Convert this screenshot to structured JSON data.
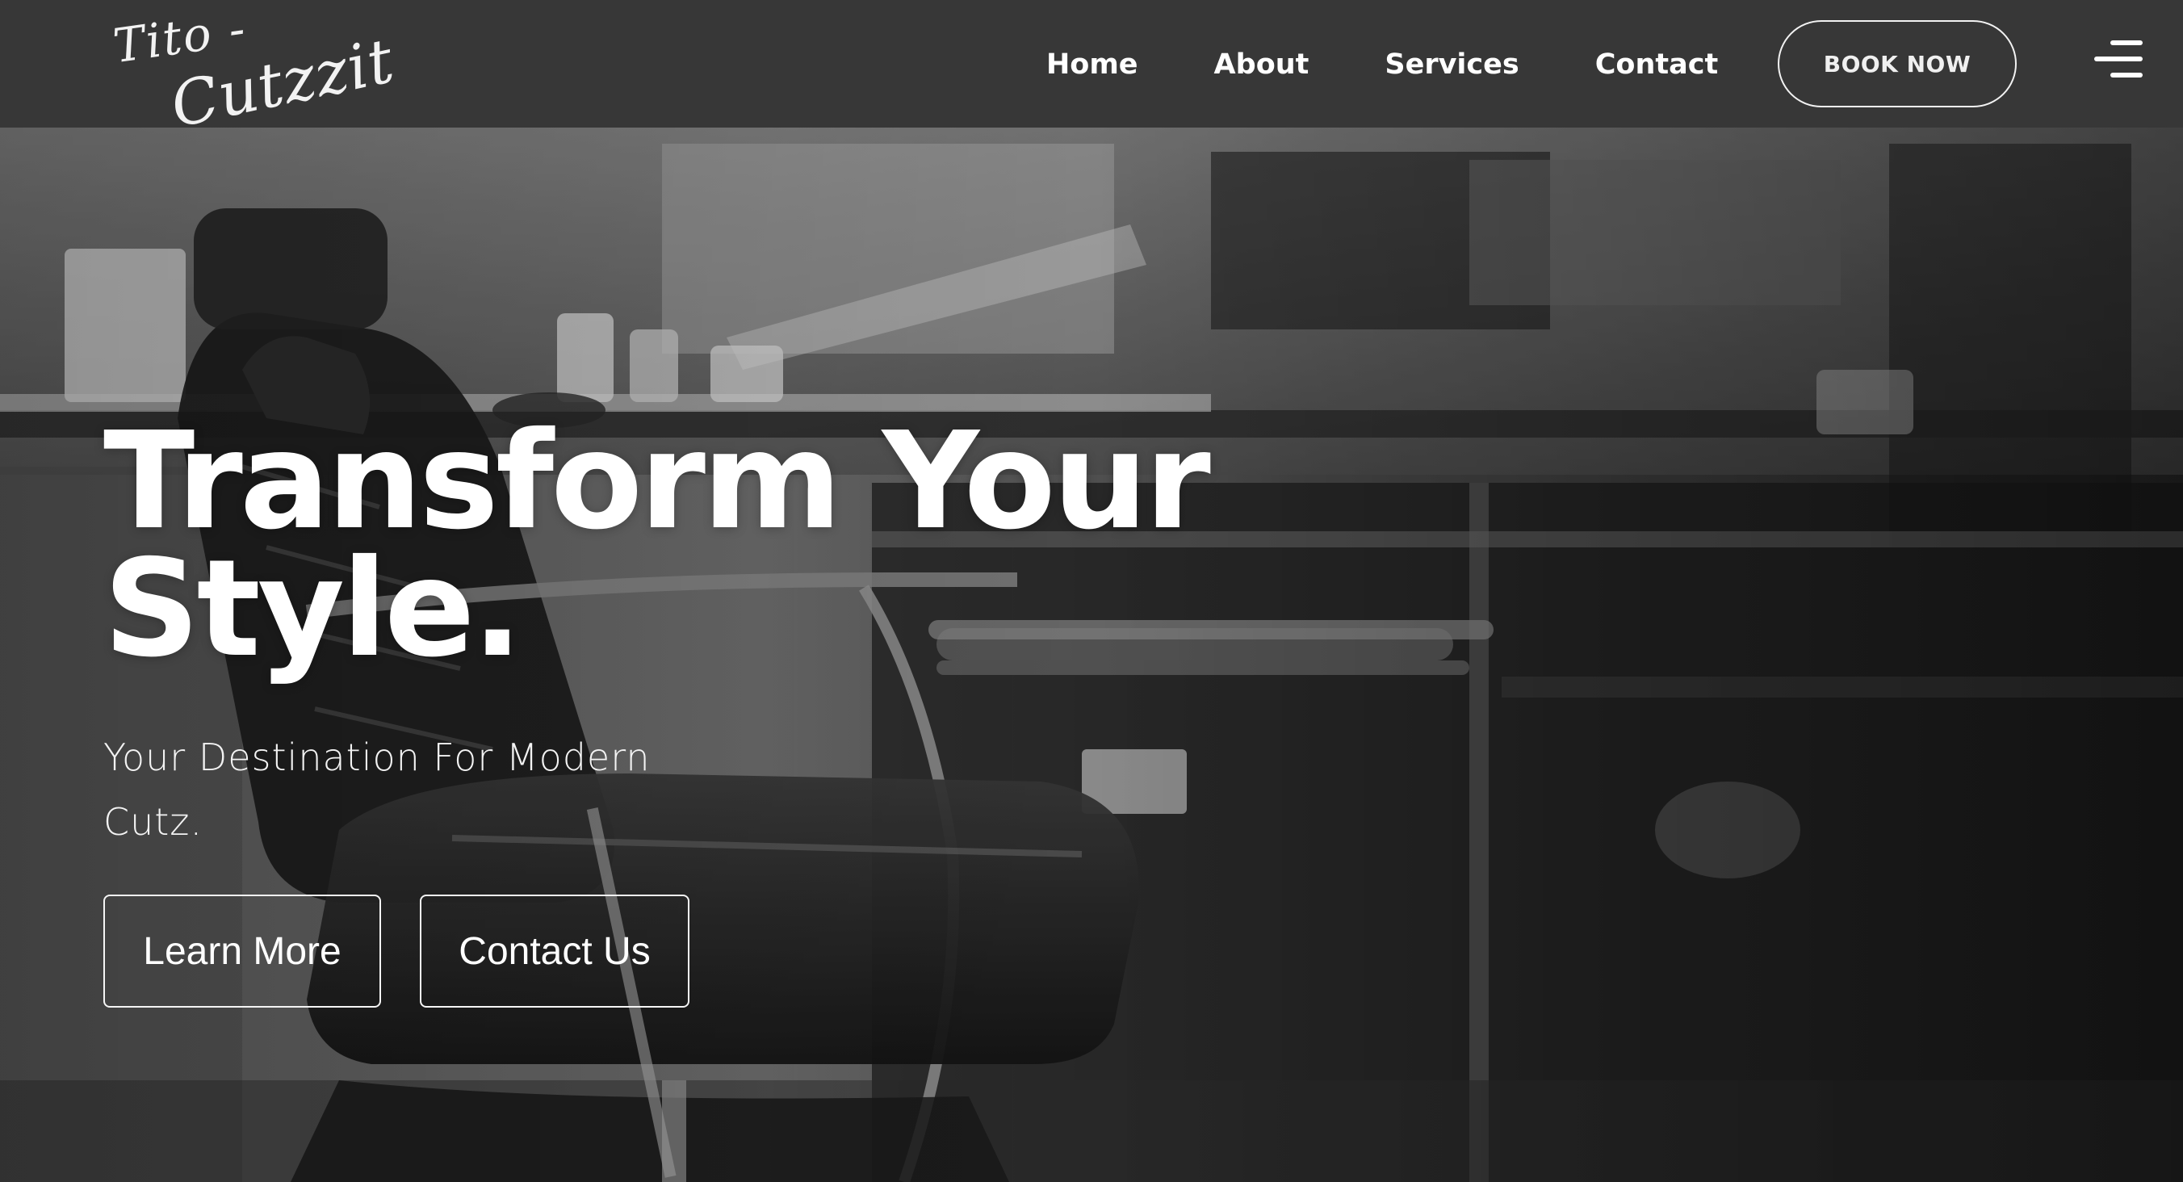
{
  "header": {
    "logo": {
      "line1": "Tito -",
      "line2": "Cutzzit"
    },
    "nav": [
      {
        "label": "Home"
      },
      {
        "label": "About"
      },
      {
        "label": "Services"
      },
      {
        "label": "Contact"
      }
    ],
    "book_button": "BOOK NOW",
    "menu_icon": "hamburger-menu-icon"
  },
  "hero": {
    "title_line1": "Transform Your",
    "title_line2": "Style.",
    "subtitle_line1": "Your Destination For Modern",
    "subtitle_line2": "Cutz.",
    "primary_button": "Learn More",
    "secondary_button": "Contact Us",
    "background_image": "barbershop-chair-photo"
  },
  "colors": {
    "navbar_bg": "#373737",
    "text": "#ffffff",
    "hero_tint": "#3a3a3a"
  }
}
